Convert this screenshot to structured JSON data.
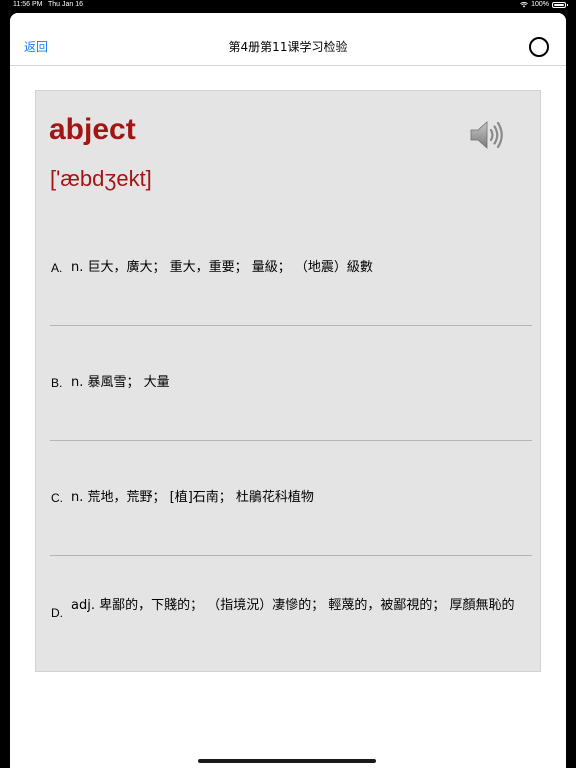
{
  "status_bar": {
    "time": "11:56 PM",
    "date": "Thu Jan 16",
    "battery": "100%"
  },
  "nav": {
    "back_label": "返回",
    "title": "第4册第11课学习检验"
  },
  "card": {
    "word": "abject",
    "phonetic": "['æbdʒekt]",
    "options": [
      {
        "letter": "A.",
        "text": "n. 巨大，廣大；  重大，重要；  量級；  （地震）級數"
      },
      {
        "letter": "B.",
        "text": "n. 暴風雪；  大量"
      },
      {
        "letter": "C.",
        "text": "n. 荒地，荒野；  [植]石南；  杜鵑花科植物"
      },
      {
        "letter": "D.",
        "text": "adj. 卑鄙的，下賤的；  （指境況）凄慘的；  輕蔑的，被鄙視的；  厚顏無恥的"
      }
    ]
  },
  "colors": {
    "accent": "#1a7cf5",
    "word": "#a31515",
    "card_bg": "#e4e4e4"
  },
  "icons": {
    "speaker": "speaker-icon",
    "record": "circle-icon",
    "wifi": "wifi-icon",
    "battery": "battery-icon"
  }
}
